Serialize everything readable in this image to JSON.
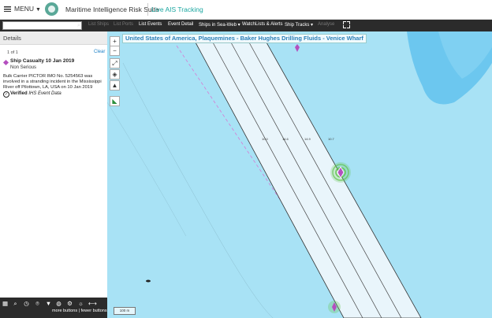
{
  "header": {
    "menu_label": "MENU",
    "app_title": "Maritime Intelligence Risk Suite",
    "live_ais_label": "Live AIS Tracking"
  },
  "toolbar": {
    "search_value": "",
    "items": [
      {
        "label": "List Ships",
        "enabled": false
      },
      {
        "label": "List Ports",
        "enabled": false
      },
      {
        "label": "List Events",
        "enabled": true
      },
      {
        "label": "Event Detail",
        "enabled": true
      },
      {
        "label": "Ships in Sea-Web ▾",
        "enabled": true
      },
      {
        "label": "WatchLists & Alerts",
        "enabled": true
      },
      {
        "label": "Ship Tracks ▾",
        "enabled": true
      },
      {
        "label": "Analyse",
        "enabled": false
      }
    ]
  },
  "details": {
    "heading": "Details",
    "count_text": "1 of 1",
    "clear_label": "Clear",
    "event_title": "Ship Casualty 10 Jan 2019",
    "severity": "Non Serious",
    "description": "Bulk Carrier PICTOR IMO No. 5254563 was involved in a stranding incident in the Mississippi River off Pilottown, LA, USA on 10 Jan 2019",
    "verified_label": "Verified",
    "verified_source": "IHS Event Data",
    "marker_color": "#b44fbf"
  },
  "bottom_bar": {
    "icons": [
      "layers-icon",
      "search-icon",
      "history-icon",
      "pin-icon",
      "filter-icon",
      "globe-icon",
      "settings-icon",
      "sun-icon",
      "minimize-icon"
    ],
    "more_less_text": "more buttons | fewer buttons"
  },
  "map": {
    "location_title": "United States of America, Plaquemines - Baker Hughes Drilling Fluids - Venice Wharf",
    "controls": [
      "zoom-in-icon",
      "zoom-out-icon",
      "fullscreen-icon",
      "locate-icon",
      "north-arrow-icon",
      "flag-icon"
    ],
    "scale_text": "100 m",
    "water_color": "#a8e2f5",
    "land_color": "#ffffff",
    "channel_color": "#e9f5fb",
    "deep_water_color": "#6cc7ef",
    "event_color": "#b44fbf",
    "halo_color": "#5fc24a"
  }
}
